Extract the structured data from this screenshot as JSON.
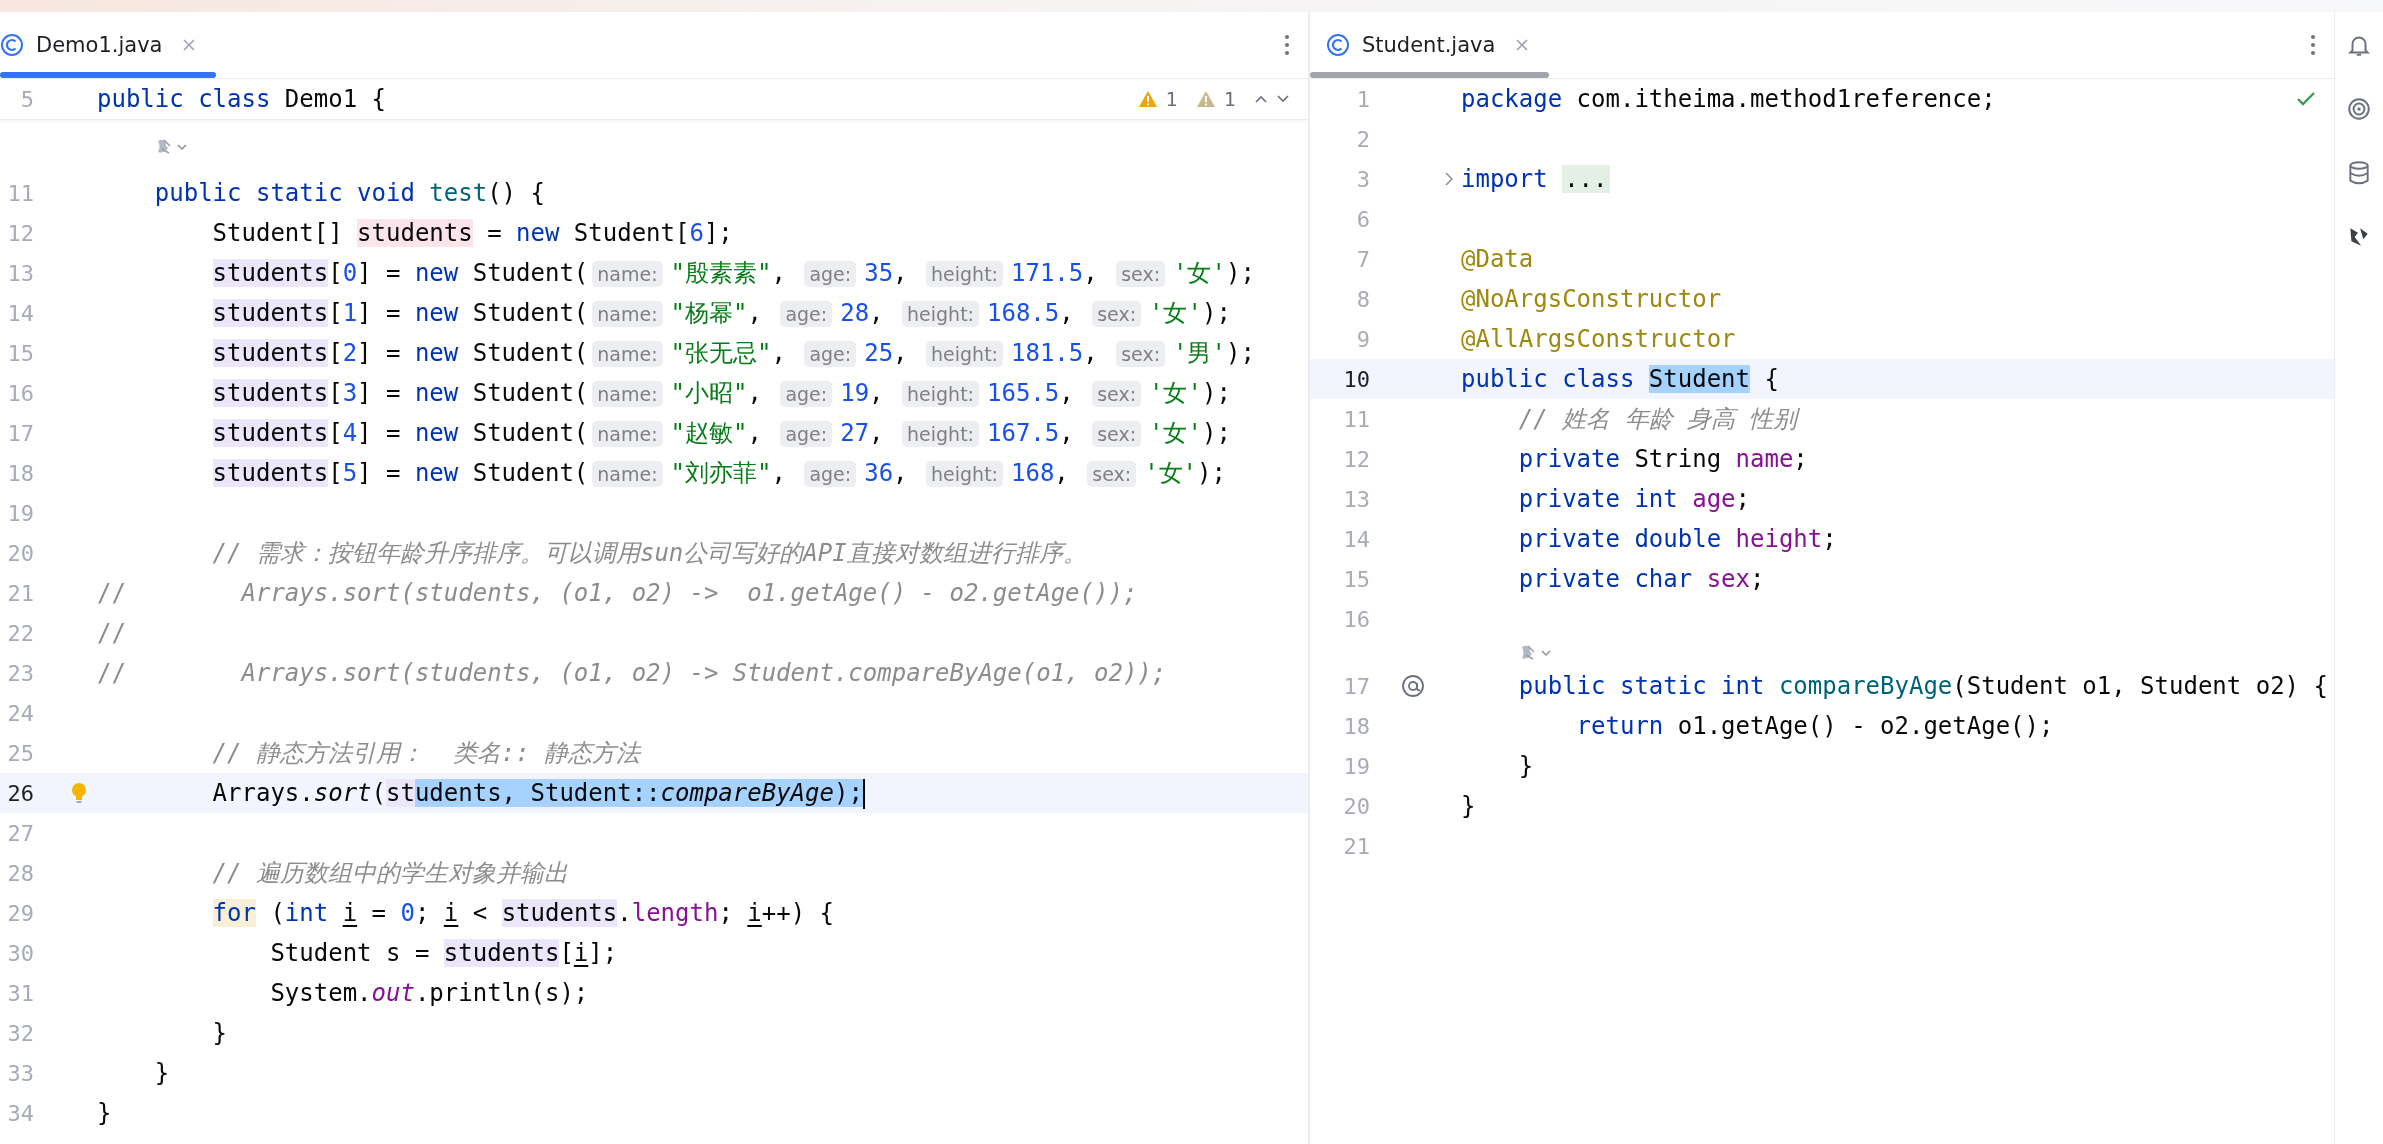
{
  "left": {
    "focused": true,
    "tab": {
      "label": "Demo1.java"
    },
    "sticky": {
      "n": "5",
      "tokens": [
        {
          "t": "public class ",
          "kind": "kw"
        },
        {
          "t": "Demo1 {",
          "kind": "p"
        }
      ]
    },
    "inspections": [
      {
        "count": "1",
        "kind": "warning"
      },
      {
        "count": "1",
        "kind": "weak"
      }
    ],
    "lines": [
      {
        "kind": "inlay"
      },
      {
        "kind": "code",
        "n": "11",
        "current": false,
        "tokens": [
          {
            "t": "    public static void ",
            "kind": "kw"
          },
          {
            "t": "test",
            "kind": "decl"
          },
          {
            "t": "() {",
            "kind": "p"
          }
        ]
      },
      {
        "kind": "code",
        "n": "12",
        "current": false,
        "tokens": [
          {
            "t": "        Student[] ",
            "kind": "p"
          },
          {
            "t": "students",
            "kind": "p",
            "write_usage": true
          },
          {
            "t": " = ",
            "kind": "p"
          },
          {
            "t": "new",
            "kind": "kw"
          },
          {
            "t": " Student[",
            "kind": "p"
          },
          {
            "t": "6",
            "kind": "num"
          },
          {
            "t": "];",
            "kind": "p"
          }
        ]
      },
      {
        "kind": "code",
        "n": "13",
        "current": false,
        "tokens": [
          {
            "t": "        students",
            "kind": "p",
            "read_usage": true
          },
          {
            "t": "[",
            "kind": "p"
          },
          {
            "t": "0",
            "kind": "num"
          },
          {
            "t": "] = ",
            "kind": "p"
          },
          {
            "t": "new",
            "kind": "kw"
          },
          {
            "t": " Student(",
            "kind": "p"
          },
          {
            "t": "name:",
            "kind": "hint"
          },
          {
            "t": "\"殷素素\"",
            "kind": "str"
          },
          {
            "t": ", ",
            "kind": "p"
          },
          {
            "t": "age:",
            "kind": "hint"
          },
          {
            "t": "35",
            "kind": "num"
          },
          {
            "t": ", ",
            "kind": "p"
          },
          {
            "t": "height:",
            "kind": "hint"
          },
          {
            "t": "171.5",
            "kind": "num"
          },
          {
            "t": ", ",
            "kind": "p"
          },
          {
            "t": "sex:",
            "kind": "hint"
          },
          {
            "t": "'女'",
            "kind": "str"
          },
          {
            "t": ");",
            "kind": "p"
          }
        ]
      },
      {
        "kind": "code",
        "n": "14",
        "current": false,
        "tokens": [
          {
            "t": "        students",
            "kind": "p",
            "read_usage": true
          },
          {
            "t": "[",
            "kind": "p"
          },
          {
            "t": "1",
            "kind": "num"
          },
          {
            "t": "] = ",
            "kind": "p"
          },
          {
            "t": "new",
            "kind": "kw"
          },
          {
            "t": " Student(",
            "kind": "p"
          },
          {
            "t": "name:",
            "kind": "hint"
          },
          {
            "t": "\"杨幂\"",
            "kind": "str"
          },
          {
            "t": ", ",
            "kind": "p"
          },
          {
            "t": "age:",
            "kind": "hint"
          },
          {
            "t": "28",
            "kind": "num"
          },
          {
            "t": ", ",
            "kind": "p"
          },
          {
            "t": "height:",
            "kind": "hint"
          },
          {
            "t": "168.5",
            "kind": "num"
          },
          {
            "t": ", ",
            "kind": "p"
          },
          {
            "t": "sex:",
            "kind": "hint"
          },
          {
            "t": "'女'",
            "kind": "str"
          },
          {
            "t": ");",
            "kind": "p"
          }
        ]
      },
      {
        "kind": "code",
        "n": "15",
        "current": false,
        "tokens": [
          {
            "t": "        students",
            "kind": "p",
            "read_usage": true
          },
          {
            "t": "[",
            "kind": "p"
          },
          {
            "t": "2",
            "kind": "num"
          },
          {
            "t": "] = ",
            "kind": "p"
          },
          {
            "t": "new",
            "kind": "kw"
          },
          {
            "t": " Student(",
            "kind": "p"
          },
          {
            "t": "name:",
            "kind": "hint"
          },
          {
            "t": "\"张无忌\"",
            "kind": "str"
          },
          {
            "t": ", ",
            "kind": "p"
          },
          {
            "t": "age:",
            "kind": "hint"
          },
          {
            "t": "25",
            "kind": "num"
          },
          {
            "t": ", ",
            "kind": "p"
          },
          {
            "t": "height:",
            "kind": "hint"
          },
          {
            "t": "181.5",
            "kind": "num"
          },
          {
            "t": ", ",
            "kind": "p"
          },
          {
            "t": "sex:",
            "kind": "hint"
          },
          {
            "t": "'男'",
            "kind": "str"
          },
          {
            "t": ");",
            "kind": "p"
          }
        ]
      },
      {
        "kind": "code",
        "n": "16",
        "current": false,
        "tokens": [
          {
            "t": "        students",
            "kind": "p",
            "read_usage": true
          },
          {
            "t": "[",
            "kind": "p"
          },
          {
            "t": "3",
            "kind": "num"
          },
          {
            "t": "] = ",
            "kind": "p"
          },
          {
            "t": "new",
            "kind": "kw"
          },
          {
            "t": " Student(",
            "kind": "p"
          },
          {
            "t": "name:",
            "kind": "hint"
          },
          {
            "t": "\"小昭\"",
            "kind": "str"
          },
          {
            "t": ", ",
            "kind": "p"
          },
          {
            "t": "age:",
            "kind": "hint"
          },
          {
            "t": "19",
            "kind": "num"
          },
          {
            "t": ", ",
            "kind": "p"
          },
          {
            "t": "height:",
            "kind": "hint"
          },
          {
            "t": "165.5",
            "kind": "num"
          },
          {
            "t": ", ",
            "kind": "p"
          },
          {
            "t": "sex:",
            "kind": "hint"
          },
          {
            "t": "'女'",
            "kind": "str"
          },
          {
            "t": ");",
            "kind": "p"
          }
        ]
      },
      {
        "kind": "code",
        "n": "17",
        "current": false,
        "tokens": [
          {
            "t": "        students",
            "kind": "p",
            "read_usage": true
          },
          {
            "t": "[",
            "kind": "p"
          },
          {
            "t": "4",
            "kind": "num"
          },
          {
            "t": "] = ",
            "kind": "p"
          },
          {
            "t": "new",
            "kind": "kw"
          },
          {
            "t": " Student(",
            "kind": "p"
          },
          {
            "t": "name:",
            "kind": "hint"
          },
          {
            "t": "\"赵敏\"",
            "kind": "str"
          },
          {
            "t": ", ",
            "kind": "p"
          },
          {
            "t": "age:",
            "kind": "hint"
          },
          {
            "t": "27",
            "kind": "num"
          },
          {
            "t": ", ",
            "kind": "p"
          },
          {
            "t": "height:",
            "kind": "hint"
          },
          {
            "t": "167.5",
            "kind": "num"
          },
          {
            "t": ", ",
            "kind": "p"
          },
          {
            "t": "sex:",
            "kind": "hint"
          },
          {
            "t": "'女'",
            "kind": "str"
          },
          {
            "t": ");",
            "kind": "p"
          }
        ]
      },
      {
        "kind": "code",
        "n": "18",
        "current": false,
        "tokens": [
          {
            "t": "        students",
            "kind": "p",
            "read_usage": true
          },
          {
            "t": "[",
            "kind": "p"
          },
          {
            "t": "5",
            "kind": "num"
          },
          {
            "t": "] = ",
            "kind": "p"
          },
          {
            "t": "new",
            "kind": "kw"
          },
          {
            "t": " Student(",
            "kind": "p"
          },
          {
            "t": "name:",
            "kind": "hint"
          },
          {
            "t": "\"刘亦菲\"",
            "kind": "str"
          },
          {
            "t": ", ",
            "kind": "p"
          },
          {
            "t": "age:",
            "kind": "hint"
          },
          {
            "t": "36",
            "kind": "num"
          },
          {
            "t": ", ",
            "kind": "p"
          },
          {
            "t": "height:",
            "kind": "hint"
          },
          {
            "t": "168",
            "kind": "num"
          },
          {
            "t": ", ",
            "kind": "p"
          },
          {
            "t": "sex:",
            "kind": "hint"
          },
          {
            "t": "'女'",
            "kind": "str"
          },
          {
            "t": ");",
            "kind": "p"
          }
        ]
      },
      {
        "kind": "code",
        "n": "19",
        "current": false
      },
      {
        "kind": "code",
        "n": "20",
        "current": false,
        "tokens": [
          {
            "t": "        // 需求：按钮年龄升序排序。可以调用sun公司写好的API直接对数组进行排序。",
            "kind": "cm"
          }
        ]
      },
      {
        "kind": "code",
        "n": "21",
        "current": false,
        "tokens": [
          {
            "t": "//",
            "kind": "cmm"
          },
          {
            "t": "        Arrays.sort(students, (o1, o2) ->  o1.getAge() - o2.getAge());",
            "kind": "cm"
          }
        ]
      },
      {
        "kind": "code",
        "n": "22",
        "current": false,
        "tokens": [
          {
            "t": "//",
            "kind": "cmm"
          }
        ]
      },
      {
        "kind": "code",
        "n": "23",
        "current": false,
        "tokens": [
          {
            "t": "//",
            "kind": "cmm"
          },
          {
            "t": "        Arrays.sort(students, (o1, o2) -> Student.compareByAge(o1, o2));",
            "kind": "cm"
          }
        ]
      },
      {
        "kind": "code",
        "n": "24",
        "current": false
      },
      {
        "kind": "code",
        "n": "25",
        "current": false,
        "tokens": [
          {
            "t": "        // 静态方法引用：  类名:: 静态方法",
            "kind": "cm"
          }
        ]
      },
      {
        "kind": "code",
        "n": "26",
        "current": true,
        "gutter": {
          "kind": "bulb"
        },
        "tokens": [
          {
            "t": "        Arrays.",
            "kind": "p"
          },
          {
            "t": "sort",
            "kind": "fn"
          },
          {
            "t": "(",
            "kind": "p"
          },
          {
            "t": "st",
            "kind": "p",
            "read_usage": true
          },
          {
            "t": "udents, Student::",
            "kind": "p",
            "selected": true
          },
          {
            "t": "compareByAge",
            "kind": "fn",
            "selected": true
          },
          {
            "t": ");",
            "kind": "p",
            "selected": true
          }
        ]
      },
      {
        "kind": "code",
        "n": "27",
        "current": false
      },
      {
        "kind": "code",
        "n": "28",
        "current": false,
        "tokens": [
          {
            "t": "        // 遍历数组中的学生对象并输出",
            "kind": "cm"
          }
        ]
      },
      {
        "kind": "code",
        "n": "29",
        "current": false,
        "tokens": [
          {
            "t": "        for",
            "kind": "kw",
            "brace_match": true
          },
          {
            "t": " (",
            "kind": "p"
          },
          {
            "t": "int",
            "kind": "kw"
          },
          {
            "t": " i",
            "kind": "var"
          },
          {
            "t": " = ",
            "kind": "p"
          },
          {
            "t": "0",
            "kind": "num"
          },
          {
            "t": "; ",
            "kind": "p"
          },
          {
            "t": "i",
            "kind": "var"
          },
          {
            "t": " < ",
            "kind": "p"
          },
          {
            "t": "students",
            "kind": "p",
            "read_usage": true
          },
          {
            "t": ".",
            "kind": "p"
          },
          {
            "t": "length",
            "kind": "fld"
          },
          {
            "t": "; ",
            "kind": "p"
          },
          {
            "t": "i",
            "kind": "var"
          },
          {
            "t": "++) {",
            "kind": "p"
          }
        ]
      },
      {
        "kind": "code",
        "n": "30",
        "current": false,
        "tokens": [
          {
            "t": "            Student s = ",
            "kind": "p"
          },
          {
            "t": "students",
            "kind": "p",
            "read_usage": true
          },
          {
            "t": "[",
            "kind": "p"
          },
          {
            "t": "i",
            "kind": "var"
          },
          {
            "t": "];",
            "kind": "p"
          }
        ]
      },
      {
        "kind": "code",
        "n": "31",
        "current": false,
        "tokens": [
          {
            "t": "            System.",
            "kind": "p"
          },
          {
            "t": "out",
            "kind": "fldi"
          },
          {
            "t": ".println(s);",
            "kind": "p"
          }
        ]
      },
      {
        "kind": "code",
        "n": "32",
        "current": false,
        "tokens": [
          {
            "t": "        }",
            "kind": "p"
          }
        ]
      },
      {
        "kind": "code",
        "n": "33",
        "current": false,
        "tokens": [
          {
            "t": "    }",
            "kind": "p"
          }
        ]
      },
      {
        "kind": "code",
        "n": "34",
        "current": false,
        "tokens": [
          {
            "t": "}",
            "kind": "p"
          }
        ]
      }
    ]
  },
  "right": {
    "focused": false,
    "tab": {
      "label": "Student.java"
    },
    "inspection_ok": true,
    "lines": [
      {
        "kind": "code",
        "n": "1",
        "current": false,
        "tokens": [
          {
            "t": "package",
            "kind": "kw"
          },
          {
            "t": " com.itheima.method1reference;",
            "kind": "p"
          }
        ]
      },
      {
        "kind": "code",
        "n": "2",
        "current": false
      },
      {
        "kind": "code",
        "n": "3",
        "current": false,
        "gutter": {
          "kind": "fold"
        },
        "tokens": [
          {
            "t": "import",
            "kind": "kw"
          },
          {
            "t": " ...",
            "kind": "dots"
          }
        ]
      },
      {
        "kind": "code",
        "n": "6",
        "current": false
      },
      {
        "kind": "code",
        "n": "7",
        "current": false,
        "tokens": [
          {
            "t": "@Data",
            "kind": "ann"
          }
        ]
      },
      {
        "kind": "code",
        "n": "8",
        "current": false,
        "tokens": [
          {
            "t": "@NoArgsConstructor",
            "kind": "ann"
          }
        ]
      },
      {
        "kind": "code",
        "n": "9",
        "current": false,
        "tokens": [
          {
            "t": "@AllArgsConstructor",
            "kind": "ann"
          }
        ]
      },
      {
        "kind": "code",
        "n": "10",
        "current": true,
        "tokens": [
          {
            "t": "public class ",
            "kind": "kw"
          },
          {
            "t": "Student",
            "kind": "p",
            "selected": true
          },
          {
            "t": " {",
            "kind": "p"
          }
        ]
      },
      {
        "kind": "code",
        "n": "11",
        "current": false,
        "tokens": [
          {
            "t": "    // 姓名 年龄 身高 性别",
            "kind": "cm"
          }
        ]
      },
      {
        "kind": "code",
        "n": "12",
        "current": false,
        "tokens": [
          {
            "t": "    private",
            "kind": "kw"
          },
          {
            "t": " String ",
            "kind": "p"
          },
          {
            "t": "name",
            "kind": "fld"
          },
          {
            "t": ";",
            "kind": "p"
          }
        ]
      },
      {
        "kind": "code",
        "n": "13",
        "current": false,
        "tokens": [
          {
            "t": "    private int ",
            "kind": "kw"
          },
          {
            "t": "age",
            "kind": "fld"
          },
          {
            "t": ";",
            "kind": "p"
          }
        ]
      },
      {
        "kind": "code",
        "n": "14",
        "current": false,
        "tokens": [
          {
            "t": "    private double ",
            "kind": "kw"
          },
          {
            "t": "height",
            "kind": "fld"
          },
          {
            "t": ";",
            "kind": "p"
          }
        ]
      },
      {
        "kind": "code",
        "n": "15",
        "current": false,
        "tokens": [
          {
            "t": "    private char ",
            "kind": "kw"
          },
          {
            "t": "sex",
            "kind": "fld"
          },
          {
            "t": ";",
            "kind": "p"
          }
        ]
      },
      {
        "kind": "code",
        "n": "16",
        "current": false
      },
      {
        "kind": "inlay"
      },
      {
        "kind": "code",
        "n": "17",
        "current": false,
        "gutter": {
          "kind": "at"
        },
        "tokens": [
          {
            "t": "    public static int ",
            "kind": "kw"
          },
          {
            "t": "compareByAge",
            "kind": "decl"
          },
          {
            "t": "(Student o1, Student o2) {",
            "kind": "p"
          }
        ]
      },
      {
        "kind": "code",
        "n": "18",
        "current": false,
        "tokens": [
          {
            "t": "        return",
            "kind": "kw"
          },
          {
            "t": " o1.getAge() - o2.getAge();",
            "kind": "p"
          }
        ]
      },
      {
        "kind": "code",
        "n": "19",
        "current": false,
        "tokens": [
          {
            "t": "    }",
            "kind": "p"
          }
        ]
      },
      {
        "kind": "code",
        "n": "20",
        "current": false,
        "tokens": [
          {
            "t": "}",
            "kind": "p"
          }
        ]
      },
      {
        "kind": "code",
        "n": "21",
        "current": false
      }
    ]
  }
}
